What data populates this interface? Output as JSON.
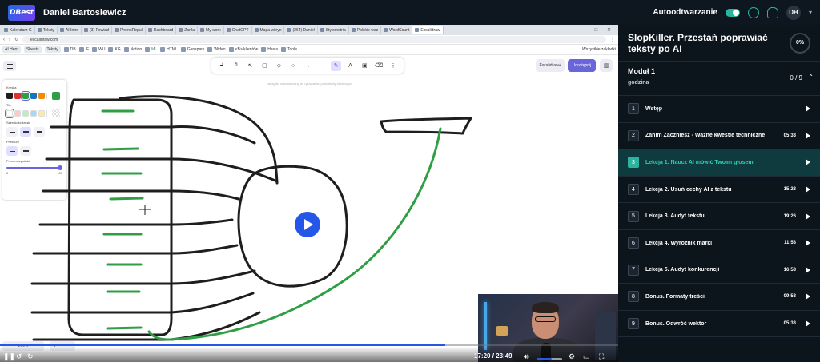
{
  "topbar": {
    "logo": "DBest",
    "user_name": "Daniel Bartosiewicz",
    "autoplay_label": "Autoodtwarzanie",
    "avatar": "DB"
  },
  "browser": {
    "tabs": [
      "Kalendarz G",
      "Teksty",
      "AI Intro",
      "(3) Powiad",
      "PromoRepul",
      "Dashboard",
      "Zarfla",
      "My work",
      "ChatGPT",
      "Mapa witryn",
      "(264) Daniel",
      "Stylometria",
      "Polskie waz",
      "WordCount",
      "Excalidraw"
    ],
    "active_tab": 14,
    "url": "excalidraw.com",
    "bookmarks": [
      "AI Hero",
      "Sheets",
      "Teksty",
      "DB",
      "IF",
      "WU",
      "KG",
      "Notion",
      "ML",
      "HTML",
      "Genspark",
      "Wideo",
      "<B> klientów",
      "Hasla",
      "Toole"
    ],
    "bookmarks_right": "Wszystkie zakładki"
  },
  "excalidraw": {
    "hint": "Narzędzi zakotwiczony do rysowania, puść kiedy skończysz",
    "library_button": "Excalidraw+",
    "share_button": "Udostępnij",
    "props": {
      "stroke_label": "Kreska",
      "background_label": "Tło",
      "stroke_width_label": "Szerokość kreski",
      "pressure_label": "Pressure",
      "opacity_label": "Przezroczystość",
      "opacity_min": "0",
      "opacity_max": "100",
      "stroke_colors": [
        "#1e1e1e",
        "#e03131",
        "#2f9e44",
        "#1971c2",
        "#f08c00"
      ],
      "selected_stroke": "#2f9e44",
      "background_colors": [
        "#ffffff",
        "#ffc9c9",
        "#b2f2bb",
        "#a5d8ff",
        "#ffec99"
      ]
    },
    "zoom": "260%"
  },
  "player": {
    "current_time": "17:20",
    "duration": "23:49",
    "progress": 0.72,
    "volume": 0.6
  },
  "sidebar": {
    "course_title": "SlopKiller. Przestań poprawiać teksty po AI",
    "progress_percent": "0%",
    "module_title": "Moduł 1",
    "module_subtitle": "godzina",
    "module_count": "0 / 9",
    "lessons": [
      {
        "num": "1",
        "title": "Wstęp",
        "duration": ""
      },
      {
        "num": "2",
        "title": "Zanim Zaczniesz - Ważne kwestie techniczne",
        "duration": "05:33"
      },
      {
        "num": "3",
        "title": "Lekcja 1. Naucz AI mówić Twoim głosem",
        "duration": ""
      },
      {
        "num": "4",
        "title": "Lekcja 2. Usuń cechy AI z tekstu",
        "duration": "15:23"
      },
      {
        "num": "5",
        "title": "Lekcja 3. Audyt tekstu",
        "duration": "19:26"
      },
      {
        "num": "6",
        "title": "Lekcja 4. Wyróżnik marki",
        "duration": "11:53"
      },
      {
        "num": "7",
        "title": "Lekcja 5. Audyt konkurencji",
        "duration": "16:53"
      },
      {
        "num": "8",
        "title": "Bonus. Formaty treści",
        "duration": "09:53"
      },
      {
        "num": "9",
        "title": "Bonus. Odwróć wektor",
        "duration": "05:33"
      }
    ],
    "active_lesson": 2,
    "accent": "#2bb5a0"
  }
}
